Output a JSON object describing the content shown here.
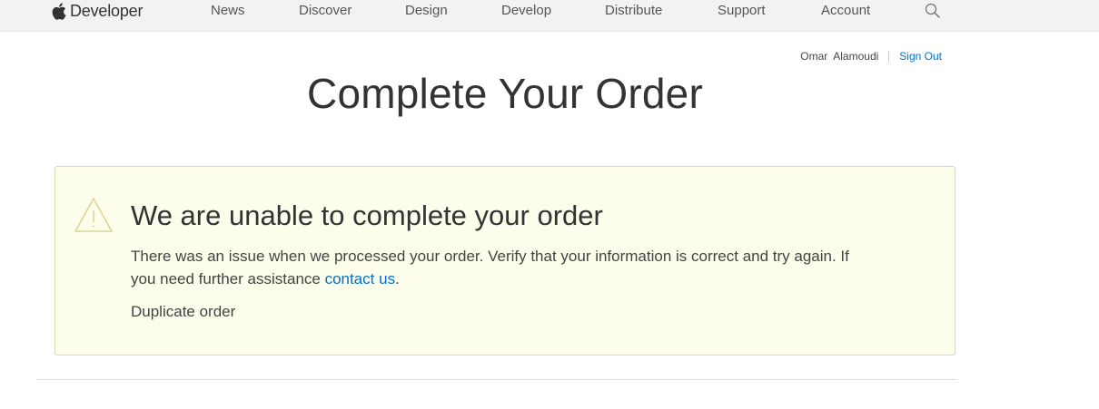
{
  "nav": {
    "brand": "Developer",
    "items": [
      "News",
      "Discover",
      "Design",
      "Develop",
      "Distribute",
      "Support",
      "Account"
    ],
    "search_icon": "search-icon",
    "apple_icon": "apple-logo-icon"
  },
  "account": {
    "user_name": "Omar  Alamoudi",
    "sign_out": "Sign Out"
  },
  "page": {
    "title": "Complete Your Order"
  },
  "alert": {
    "icon": "warning-icon",
    "heading": "We are unable to complete your order",
    "message_before": "There was an issue when we processed your order. Verify that your information is correct and try again. If you need further assistance ",
    "contact_link": "contact us",
    "message_after": ".",
    "reason": "Duplicate order"
  },
  "colors": {
    "nav_background": "#f2f2f2",
    "link": "#0070c9",
    "alert_background": "#fdfdec",
    "alert_border": "#dcd8b4",
    "warning_icon": "#d9cc8a"
  }
}
